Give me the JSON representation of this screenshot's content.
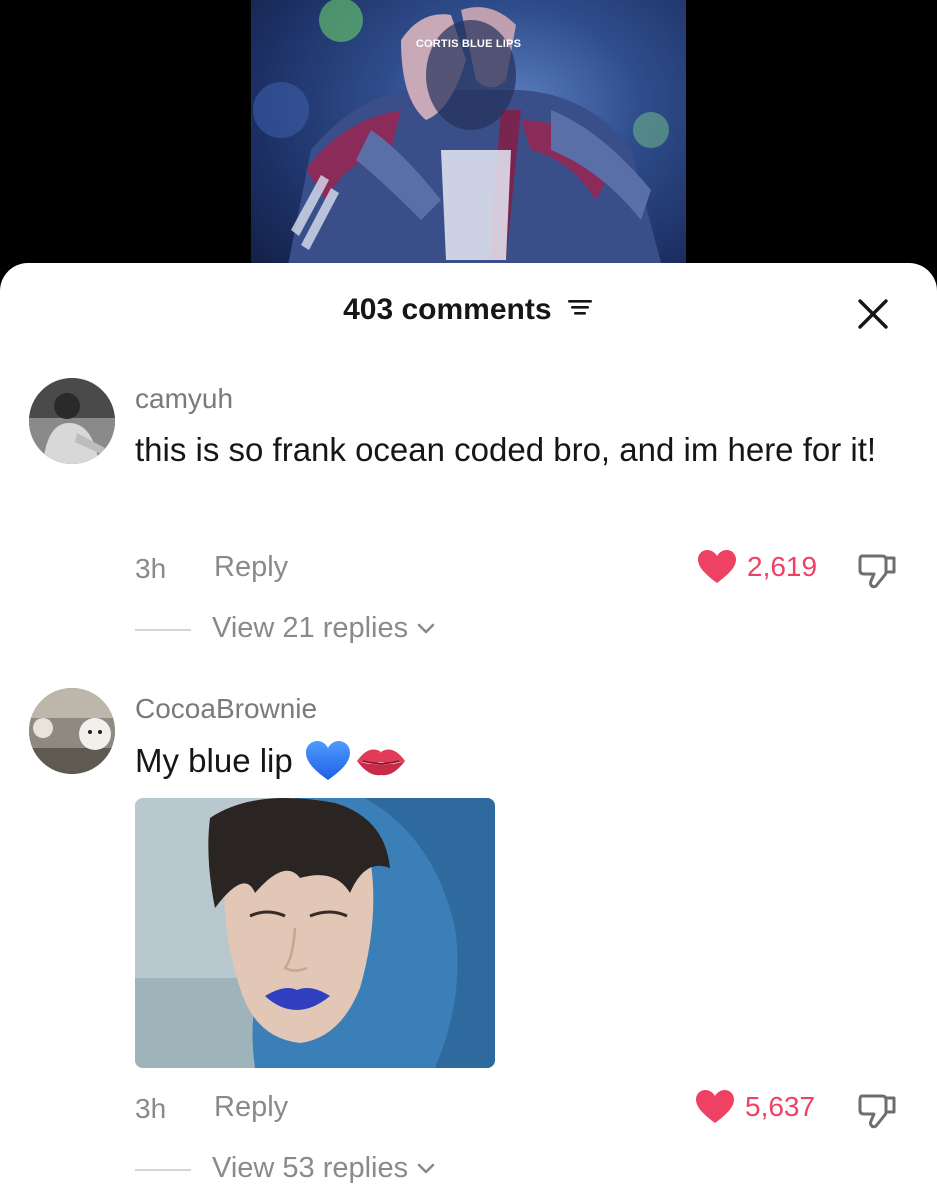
{
  "video": {
    "overlay_text": "CORTIS BLUE LIPS"
  },
  "sheet": {
    "count_label": "403 comments"
  },
  "comments": [
    {
      "username": "camyuh",
      "text": "this is so frank ocean coded bro, and im here for it!",
      "time": "3h",
      "reply_label": "Reply",
      "likes": "2,619",
      "view_replies": "View 21 replies"
    },
    {
      "username": "CocoaBrownie",
      "text": "My blue lip",
      "emojis": [
        "blue-heart-icon",
        "lips-icon"
      ],
      "time": "3h",
      "reply_label": "Reply",
      "likes": "5,637",
      "view_replies": "View 53 replies"
    }
  ],
  "colors": {
    "like_red": "#ee4164",
    "muted_gray": "#8a8a8a",
    "text_dark": "#161616",
    "blue_lips": "#2f3fbf"
  }
}
